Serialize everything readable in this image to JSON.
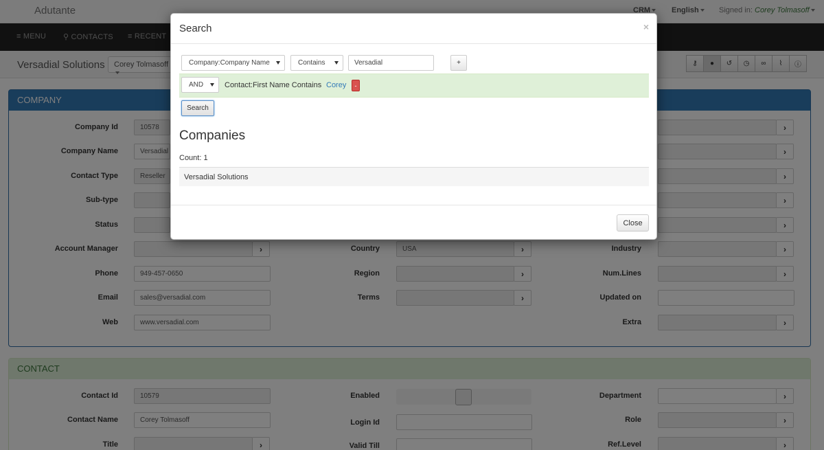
{
  "app": {
    "brand": "Adutante",
    "top_menu": {
      "crm": "CRM",
      "language": "English",
      "signed_in_label": "Signed in:",
      "user": "Corey Tolmasoff"
    }
  },
  "nav": {
    "menu": "MENU",
    "contacts": "CONTACTS",
    "recent": "RECENT"
  },
  "subbar": {
    "title": "Versadial Solutions",
    "user_select": "Corey Tolmasoff"
  },
  "toolbar": {
    "icons": [
      "key-icon",
      "user-icon",
      "history-icon",
      "clock-icon",
      "link-icon",
      "paperclip-icon",
      "info-icon"
    ]
  },
  "company": {
    "heading": "COMPANY",
    "labels": {
      "company_id": "Company Id",
      "company_name": "Company Name",
      "contact_type": "Contact Type",
      "sub_type": "Sub-type",
      "status": "Status",
      "account_manager": "Account Manager",
      "phone": "Phone",
      "email": "Email",
      "web": "Web",
      "country": "Country",
      "region": "Region",
      "terms": "Terms",
      "industry": "Industry",
      "num_lines": "Num.Lines",
      "updated_on": "Updated on",
      "extra": "Extra"
    },
    "values": {
      "company_id": "10578",
      "company_name": "Versadial S",
      "contact_type": "Reseller",
      "phone": "949-457-0650",
      "email": "sales@versadial.com",
      "web": "www.versadial.com",
      "country": "USA"
    }
  },
  "contact": {
    "heading": "CONTACT",
    "labels": {
      "contact_id": "Contact Id",
      "contact_name": "Contact Name",
      "title": "Title",
      "enabled": "Enabled",
      "login_id": "Login Id",
      "valid_till": "Valid Till",
      "department": "Department",
      "role": "Role",
      "ref_level": "Ref.Level"
    },
    "values": {
      "contact_id": "10579",
      "contact_name": "Corey Tolmasoff"
    }
  },
  "modal": {
    "title": "Search",
    "close_icon": "×",
    "field_select": "Company:Company Name",
    "operator_select": "Contains",
    "search_value": "Versadial",
    "add_label": "+",
    "condition": {
      "logic": "AND",
      "text": "Contact:First Name   Contains",
      "value": "Corey",
      "remove_label": "-"
    },
    "search_button": "Search",
    "results_heading": "Companies",
    "count": "Count: 1",
    "results": [
      "Versadial Solutions"
    ],
    "close_button": "Close"
  },
  "colors": {
    "company_header": "#337ab7",
    "contact_header": "#dff0d8",
    "condition_row": "#dff0d8",
    "remove_button": "#d9534f"
  }
}
